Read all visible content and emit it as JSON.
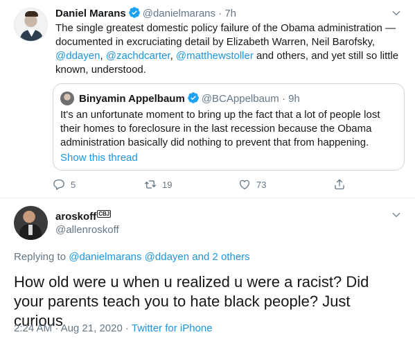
{
  "tweet": {
    "author_name": "Daniel Marans",
    "author_handle": "@danielmarans",
    "separator": "·",
    "time": "7h",
    "text_line1": "The single greatest domestic policy failure of the Obama administration —",
    "text_line2": "documented in excruciating detail by Elizabeth Warren, Neil Barofsky,",
    "mention1": "@ddayen",
    "comma1": ", ",
    "mention2": "@zachdcarter",
    "comma2": ", ",
    "mention3": "@matthewstoller",
    "text_line3_rest": " and others, and yet still so little",
    "text_line4": "known, understood.",
    "quote": {
      "author_name": "Binyamin Appelbaum",
      "author_handle": "@BCAppelbaum",
      "separator": "·",
      "time": "9h",
      "text": "It's an unfortunate moment to bring up the fact that a lot of people lost their homes to foreclosure in the last recession because the Obama administration basically did nothing to prevent that from happening.",
      "show_thread": "Show this thread"
    },
    "actions": {
      "replies": "5",
      "retweets": "19",
      "likes": "73"
    }
  },
  "reply": {
    "author_name": "aroskoff",
    "author_tag": "CBJ",
    "author_handle": "@allenroskoff",
    "replying_prefix": "Replying to ",
    "replying_to": "@danielmarans @ddayen",
    "replying_suffix": " and 2 others",
    "text": "How old were u when u realized u were a racist? Did your parents teach you to hate black people? Just curious",
    "time": "2:24 AM",
    "separator": " · ",
    "date": "Aug 21, 2020",
    "source_separator": " · ",
    "source": "Twitter for iPhone"
  },
  "colors": {
    "link": "#1b95e0",
    "secondary": "#657786",
    "primary": "#14171a",
    "border": "#ccd6dd"
  },
  "icons": [
    "verified-badge-icon",
    "chevron-down-icon",
    "reply-icon",
    "retweet-icon",
    "like-icon",
    "share-icon"
  ]
}
